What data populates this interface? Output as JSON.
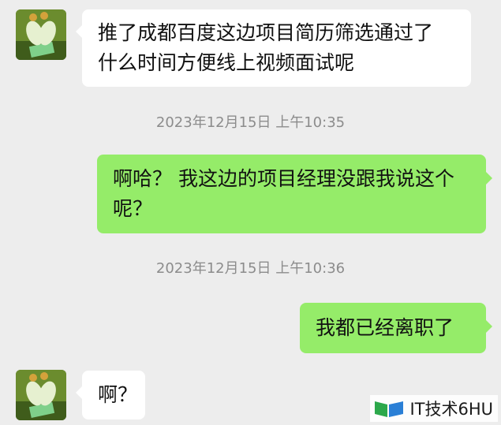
{
  "messages": [
    {
      "sender": "contact",
      "text": "推了成都百度这边项目简历筛选通过了 什么时间方便线上视频面试呢"
    },
    {
      "timestamp": "2023年12月15日 上午10:35"
    },
    {
      "sender": "me",
      "text": "啊哈？ 我这边的项目经理没跟我说这个呢？"
    },
    {
      "timestamp": "2023年12月15日 上午10:36"
    },
    {
      "sender": "me",
      "text": "我都已经离职了"
    },
    {
      "sender": "contact",
      "text": "啊？"
    }
  ],
  "watermark": {
    "text": "IT技术6HU",
    "icon": "book-logo-icon"
  },
  "colors": {
    "background": "#ededed",
    "incoming": "#ffffff",
    "outgoing": "#95ec69"
  }
}
